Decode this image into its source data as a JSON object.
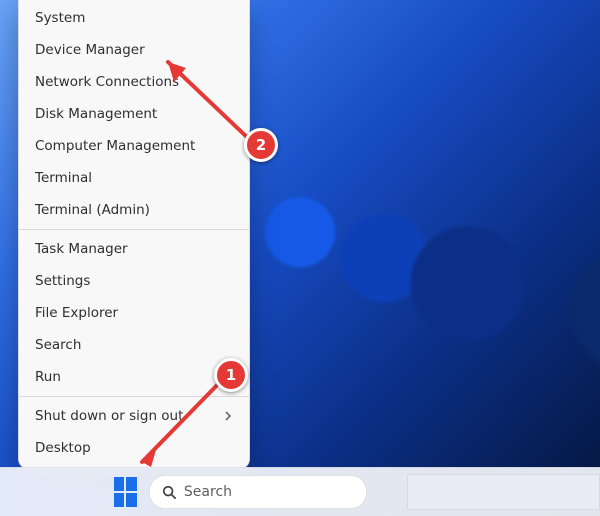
{
  "taskbar": {
    "search_placeholder": "Search"
  },
  "power_menu": {
    "items": [
      {
        "label": "System",
        "submenu": false
      },
      {
        "label": "Device Manager",
        "submenu": false
      },
      {
        "label": "Network Connections",
        "submenu": false
      },
      {
        "label": "Disk Management",
        "submenu": false
      },
      {
        "label": "Computer Management",
        "submenu": false
      },
      {
        "label": "Terminal",
        "submenu": false
      },
      {
        "label": "Terminal (Admin)",
        "submenu": false
      },
      "sep",
      {
        "label": "Task Manager",
        "submenu": false
      },
      {
        "label": "Settings",
        "submenu": false
      },
      {
        "label": "File Explorer",
        "submenu": false
      },
      {
        "label": "Search",
        "submenu": false
      },
      {
        "label": "Run",
        "submenu": false
      },
      "sep",
      {
        "label": "Shut down or sign out",
        "submenu": true
      },
      {
        "label": "Desktop",
        "submenu": false
      }
    ]
  },
  "annotations": {
    "step1": {
      "label": "1"
    },
    "step2": {
      "label": "2"
    }
  }
}
